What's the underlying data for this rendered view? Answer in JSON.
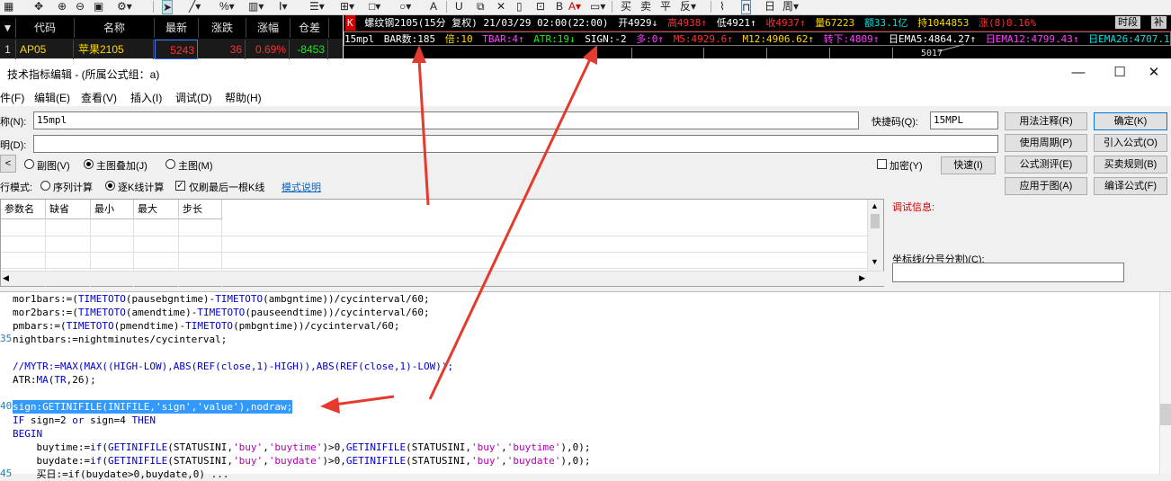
{
  "quote_table": {
    "headers": [
      "▼",
      "代码",
      "名称",
      "最新",
      "涨跌",
      "涨幅",
      "仓差"
    ],
    "row": {
      "index": "1",
      "code": "AP05",
      "name": "苹果2105",
      "last": "5243",
      "change": "36",
      "pct": "0.69%",
      "oi_diff": "-8453"
    }
  },
  "chart_header": {
    "badge": "K",
    "title": "螺纹钢2105(15分 复权) 21/03/29 02:00(22:00)",
    "open": "开4929↓",
    "high": "高4938↑",
    "low": "低4921↑",
    "close": "收4937↑",
    "volume": "量67223",
    "amount": "额33.1亿",
    "hold": "持1044853",
    "chg": "涨(8)0.16%",
    "btn_share": "时段",
    "btn_more": "补"
  },
  "chart_line2": {
    "name": "15mpl",
    "bar_count": "BAR数:185",
    "bei": "倍:10",
    "tbar": "TBAR:4↑",
    "atr": "ATR:19↓",
    "sign": "SIGN:-2",
    "duo": "多:0↑",
    "m5": "M5:4929.6↑",
    "m12": "M12:4906.62↑",
    "zhuanxia": "转下:4809↑",
    "ema5": "日EMA5:4864.27↑",
    "ema12": "日EMA12:4799.43↑",
    "ema26": "日EMA26:4707.1",
    "price_mark": "5017"
  },
  "window": {
    "title": "技术指标编辑 - (所属公式组：a)",
    "minimize": "—",
    "maximize": "☐",
    "close": "✕"
  },
  "menu": [
    "件(F)",
    "编辑(E)",
    "查看(V)",
    "插入(I)",
    "调试(D)",
    "帮助(H)"
  ],
  "form": {
    "name_label": "称(N):",
    "name_value": "15mpl",
    "shortcut_label": "快捷码(Q):",
    "shortcut_value": "15MPL",
    "desc_label": "明(D):",
    "desc_value": "",
    "radio_sub": "副图(V)",
    "radio_overlay": "主图叠加(J)",
    "radio_main": "主图(M)",
    "encrypt": "加密(Y)",
    "quick": "快速(I)",
    "exec_mode_label": "行模式:",
    "exec_seq": "序列计算",
    "exec_bar": "逐K线计算",
    "only_last": "仅刷最后一根K线",
    "mode_help": "模式说明"
  },
  "side_buttons": {
    "usage": "用法注释(R)",
    "ok": "确定(K)",
    "period": "使用周期(P)",
    "import": "引入公式(O)",
    "test": "公式测评(E)",
    "rules": "买卖规则(B)",
    "apply": "应用于图(A)",
    "compile": "编译公式(F)"
  },
  "debug": {
    "label": "调试信息:",
    "axis_label": "坐标线(分号分割)(C):"
  },
  "param_grid": {
    "headers": [
      "参数名",
      "缺省",
      "最小",
      "最大",
      "步长"
    ]
  },
  "code_lines": [
    {
      "num": "",
      "text": "mor1bars:=(TIMETOTO(pausebgntime)-TIMETOTO(ambgntime))/cycinterval/60;"
    },
    {
      "num": "",
      "text": "mor2bars:=(TIMETOTO(amendtime)-TIMETOTO(pauseendtime))/cycinterval/60;"
    },
    {
      "num": "",
      "text": "pmbars:=(TIMETOTO(pmendtime)-TIMETOTO(pmbgntime))/cycinterval/60;"
    },
    {
      "num": "35",
      "text": "nightbars:=nightminutes/cycinterval;"
    },
    {
      "num": "",
      "text": ""
    },
    {
      "num": "",
      "text": "//MYTR:=MAX(MAX((HIGH-LOW),ABS(REF(close,1)-HIGH)),ABS(REF(close,1)-LOW));"
    },
    {
      "num": "",
      "text": "ATR:MA(TR,26);"
    },
    {
      "num": "",
      "text": ""
    },
    {
      "num": "40",
      "text": "sign:GETINIFILE(INIFILE,'sign','value'),nodraw;"
    },
    {
      "num": "",
      "text": "IF sign=2 or sign=4 THEN"
    },
    {
      "num": "",
      "text": "BEGIN"
    },
    {
      "num": "",
      "text": "    buytime:=if(GETINIFILE(STATUSINI,'buy','buytime')>0,GETINIFILE(STATUSINI,'buy','buytime'),0);"
    },
    {
      "num": "",
      "text": "    buydate:=if(GETINIFILE(STATUSINI,'buy','buydate')>0,GETINIFILE(STATUSINI,'buy','buydate'),0);"
    },
    {
      "num": "45",
      "text": "    买日:=if(buydate>0,buydate,0) ... "
    }
  ],
  "colors": {
    "arrow": "#e53a2e",
    "selection": "#3399ff",
    "keyword": "#0000cc",
    "string": "#b000b0"
  }
}
